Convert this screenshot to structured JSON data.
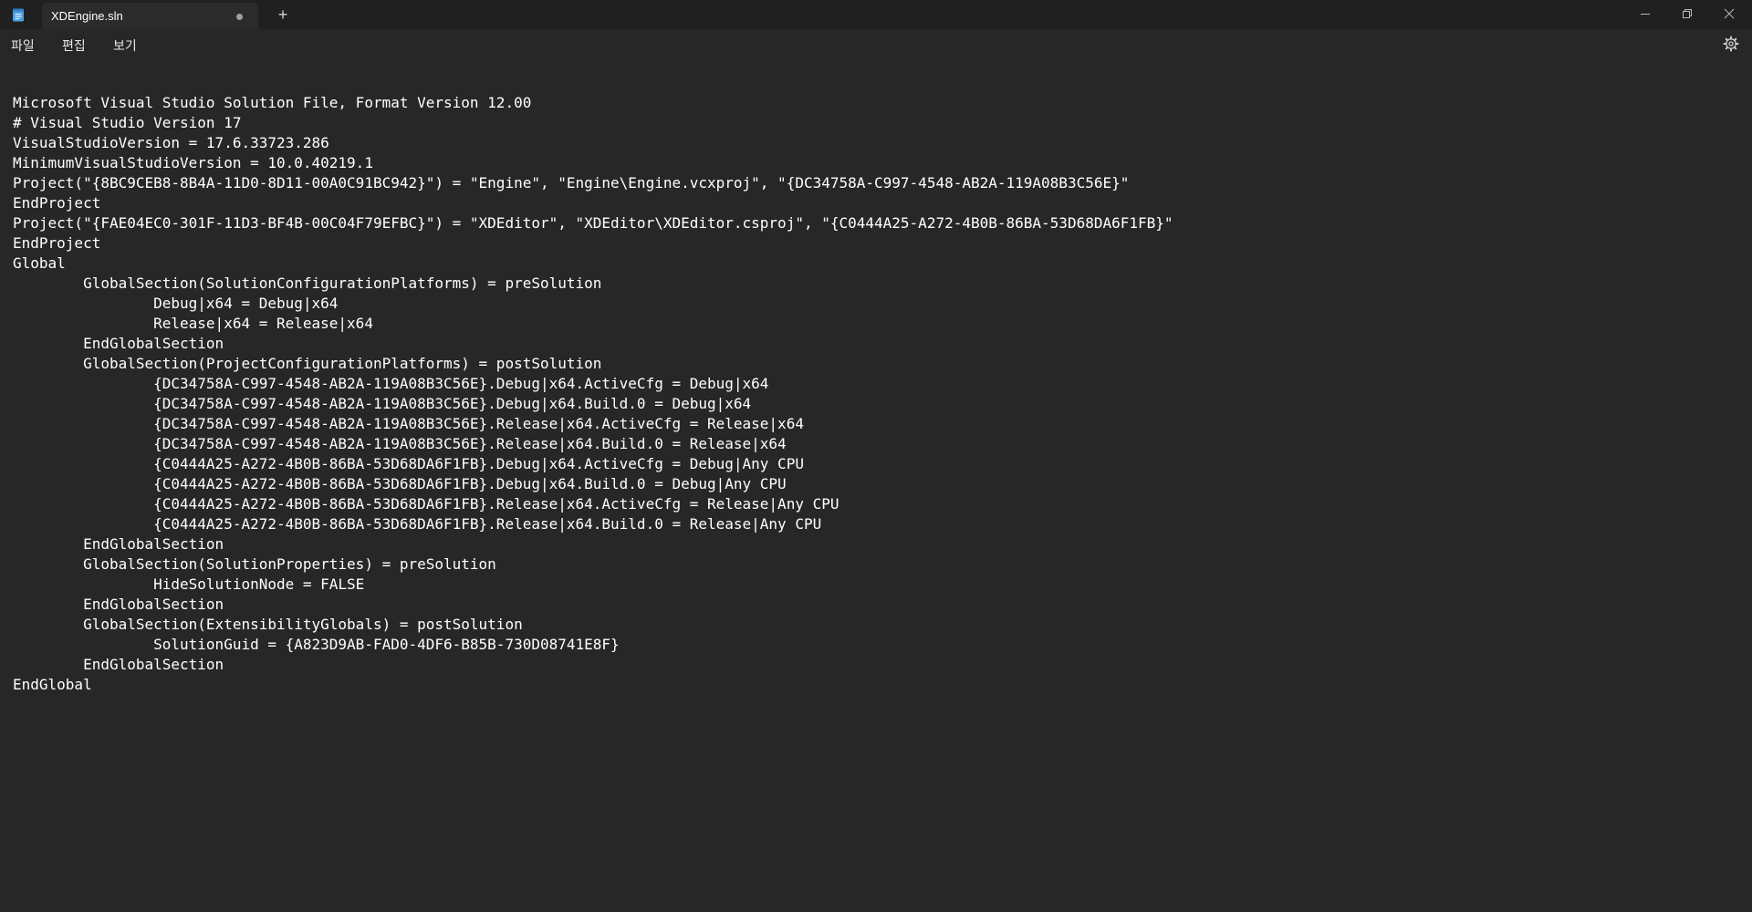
{
  "window": {
    "tab_title": "XDEngine.sln",
    "new_tab_label": "+"
  },
  "menu": {
    "items": [
      "파일",
      "편집",
      "보기"
    ]
  },
  "icons": {
    "app": "notepad-icon",
    "tab_status": "unsaved-dot-icon",
    "minimize": "minimize-icon",
    "maximize": "restore-icon",
    "close": "close-icon",
    "settings": "gear-icon"
  },
  "editor": {
    "lines": [
      "Microsoft Visual Studio Solution File, Format Version 12.00",
      "# Visual Studio Version 17",
      "VisualStudioVersion = 17.6.33723.286",
      "MinimumVisualStudioVersion = 10.0.40219.1",
      "Project(\"{8BC9CEB8-8B4A-11D0-8D11-00A0C91BC942}\") = \"Engine\", \"Engine\\Engine.vcxproj\", \"{DC34758A-C997-4548-AB2A-119A08B3C56E}\"",
      "EndProject",
      "Project(\"{FAE04EC0-301F-11D3-BF4B-00C04F79EFBC}\") = \"XDEditor\", \"XDEditor\\XDEditor.csproj\", \"{C0444A25-A272-4B0B-86BA-53D68DA6F1FB}\"",
      "EndProject",
      "Global",
      "\tGlobalSection(SolutionConfigurationPlatforms) = preSolution",
      "\t\tDebug|x64 = Debug|x64",
      "\t\tRelease|x64 = Release|x64",
      "\tEndGlobalSection",
      "\tGlobalSection(ProjectConfigurationPlatforms) = postSolution",
      "\t\t{DC34758A-C997-4548-AB2A-119A08B3C56E}.Debug|x64.ActiveCfg = Debug|x64",
      "\t\t{DC34758A-C997-4548-AB2A-119A08B3C56E}.Debug|x64.Build.0 = Debug|x64",
      "\t\t{DC34758A-C997-4548-AB2A-119A08B3C56E}.Release|x64.ActiveCfg = Release|x64",
      "\t\t{DC34758A-C997-4548-AB2A-119A08B3C56E}.Release|x64.Build.0 = Release|x64",
      "\t\t{C0444A25-A272-4B0B-86BA-53D68DA6F1FB}.Debug|x64.ActiveCfg = Debug|Any CPU",
      "\t\t{C0444A25-A272-4B0B-86BA-53D68DA6F1FB}.Debug|x64.Build.0 = Debug|Any CPU",
      "\t\t{C0444A25-A272-4B0B-86BA-53D68DA6F1FB}.Release|x64.ActiveCfg = Release|Any CPU",
      "\t\t{C0444A25-A272-4B0B-86BA-53D68DA6F1FB}.Release|x64.Build.0 = Release|Any CPU",
      "\tEndGlobalSection",
      "\tGlobalSection(SolutionProperties) = preSolution",
      "\t\tHideSolutionNode = FALSE",
      "\tEndGlobalSection",
      "\tGlobalSection(ExtensibilityGlobals) = postSolution",
      "\t\tSolutionGuid = {A823D9AB-FAD0-4DF6-B85B-730D08741E8F}",
      "\tEndGlobalSection",
      "EndGlobal"
    ]
  }
}
